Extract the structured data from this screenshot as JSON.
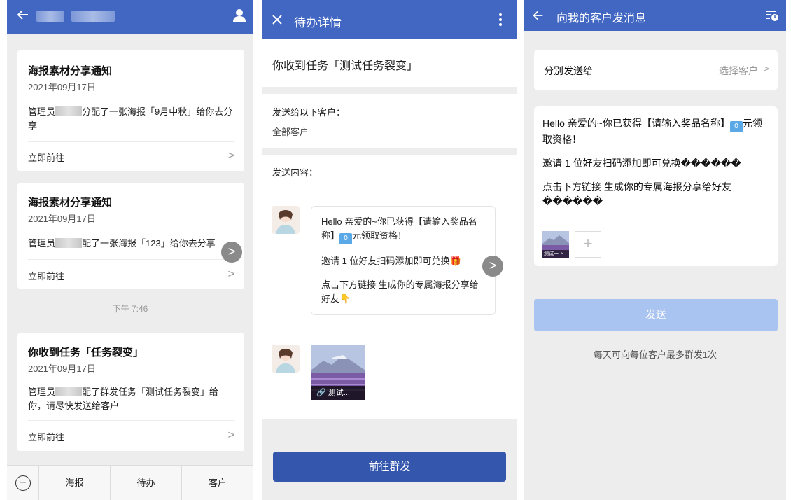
{
  "panel1": {
    "back_icon": "arrow-left-icon",
    "user_icon": "person-icon",
    "cards": [
      {
        "title": "海报素材分享通知",
        "date": "2021年09月17日",
        "body_pre": "管理员",
        "body_post": "分配了一张海报「9月中秋」给你去分享",
        "action": "立即前往",
        "chevron": ">"
      },
      {
        "title": "海报素材分享通知",
        "date": "2021年09月17日",
        "body_pre": "管理员",
        "body_post": "配了一张海报「123」给你去分享",
        "action": "立即前往",
        "chevron": ">"
      },
      {
        "title": "你收到任务「任务裂变」",
        "date": "2021年09月17日",
        "body_pre": "管理员",
        "body_post": "配了群发任务「测试任务裂变」给你，请尽快发送给客户",
        "action": "立即前往",
        "chevron": ">"
      }
    ],
    "timestamp": "下午 7:46",
    "fab": ">",
    "tabs": [
      "海报",
      "待办",
      "客户"
    ]
  },
  "panel2": {
    "close_icon": "close-icon",
    "title": "待办详情",
    "more_icon": "more-vertical-icon",
    "task_title": "你收到任务「测试任务裂变」",
    "send_to_label": "发送给以下客户：",
    "send_to_value": "全部客户",
    "content_label": "发送内容：",
    "message": {
      "line1": "Hello 亲爱的~你已获得【请输入奖品名称】",
      "kbox": "0",
      "line1_end": "元领取资格！",
      "line2": "邀请 1 位好友扫码添加即可兑换🎁",
      "line3": "点击下方链接 生成你的专属海报分享给好友👇"
    },
    "poster_caption": "测试...",
    "fab": ">",
    "button": "前往群发"
  },
  "panel3": {
    "back_icon": "arrow-left-icon",
    "title": "向我的客户发消息",
    "history_icon": "list-clock-icon",
    "recipient_label": "分别发送给",
    "recipient_value": "选择客户",
    "recipient_chevron": ">",
    "message": {
      "line1": "Hello 亲爱的~你已获得【请输入奖品名称】",
      "kbox": "0",
      "line1_end": "元领取资格！",
      "line2": "邀请 1 位好友扫码添加即可兑换������",
      "line3": "点击下方链接 生成你的专属海报分享给好友������"
    },
    "thumb_caption": "测试一下",
    "add_icon": "+",
    "send_button": "发送",
    "note": "每天可向每位客户最多群发1次"
  },
  "colors": {
    "header": "#4267c2",
    "button": "#3457ad",
    "disabled_button": "#a9c4f0"
  }
}
